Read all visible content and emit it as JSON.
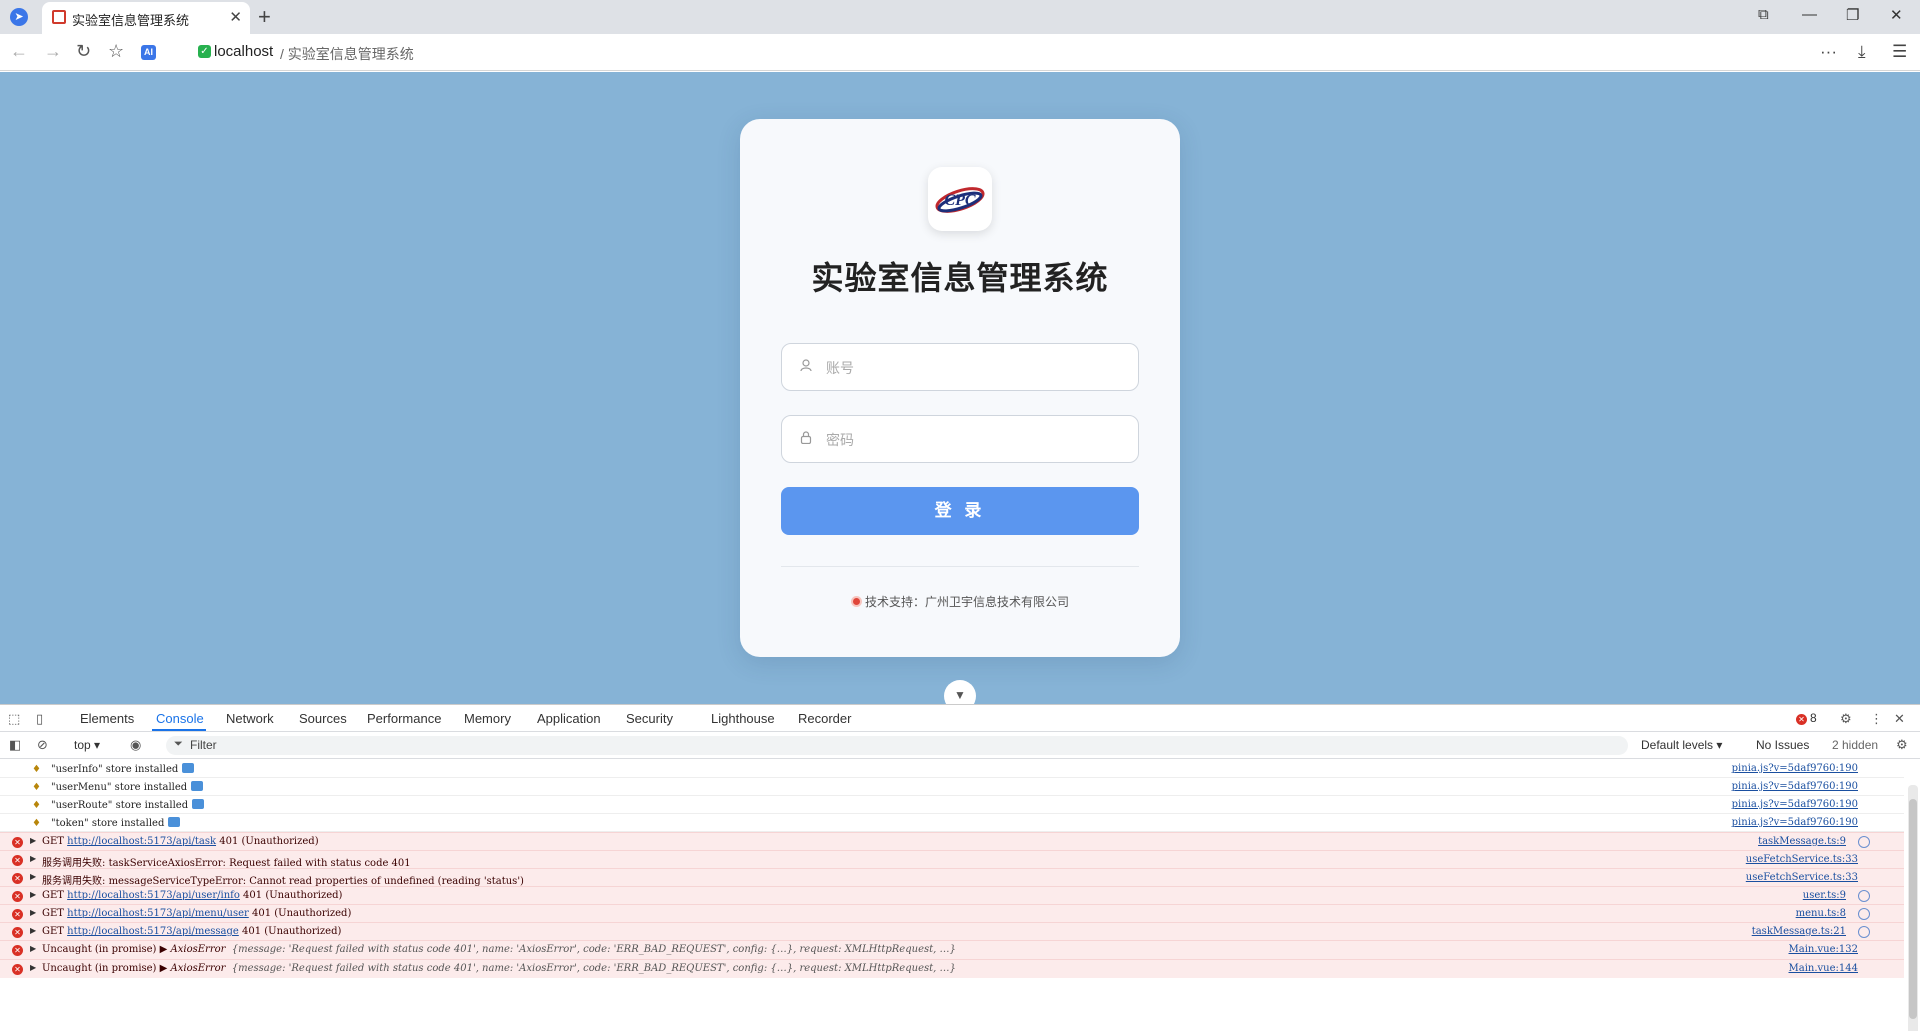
{
  "browser": {
    "tab_title": "实验室信息管理系统",
    "tab_close": "✕",
    "new_tab": "+",
    "url_host": "localhost",
    "url_path": "/ 实验室信息管理系统",
    "menu_dots": "···",
    "menu_icon": "☰"
  },
  "login": {
    "title": "实验室信息管理系统",
    "account_placeholder": "账号",
    "password_placeholder": "密码",
    "login_button": "登 录",
    "support_text": "技术支持：广州卫宇信息技术有限公司",
    "logo_text": "CPC",
    "colors": {
      "page_bg": "#86b3d6",
      "button": "#5b96ef",
      "card": "#f7f9fc"
    }
  },
  "devtools": {
    "tabs": [
      "Elements",
      "Console",
      "Network",
      "Sources",
      "Performance",
      "Memory",
      "Application",
      "Security",
      "Lighthouse",
      "Recorder"
    ],
    "active_tab": "Console",
    "error_count": "8",
    "context": "top ▾",
    "filter_placeholder": "Filter",
    "levels": "Default levels ▾",
    "issues": "No Issues",
    "hidden": "2 hidden",
    "logs": [
      {
        "msg": "\"userInfo\" store installed",
        "src": "pinia.js?v=5daf9760:190"
      },
      {
        "msg": "\"userMenu\" store installed",
        "src": "pinia.js?v=5daf9760:190"
      },
      {
        "msg": "\"userRoute\" store installed",
        "src": "pinia.js?v=5daf9760:190"
      },
      {
        "msg": "\"token\" store installed",
        "src": "pinia.js?v=5daf9760:190"
      }
    ],
    "errors": [
      {
        "prefix": "GET",
        "link": "http://localhost:5173/api/task",
        "rest": "401 (Unauthorized)",
        "src": "taskMessage.ts:9"
      },
      {
        "prefix": "服务调用失败:",
        "link": "",
        "rest": "taskServiceAxiosError: Request failed with status code 401",
        "src": "useFetchService.ts:33"
      },
      {
        "prefix": "服务调用失败:",
        "link": "",
        "rest": "messageServiceTypeError: Cannot read properties of undefined (reading 'status')",
        "src": "useFetchService.ts:33"
      },
      {
        "prefix": "GET",
        "link": "http://localhost:5173/api/user/info",
        "rest": "401 (Unauthorized)",
        "src": "user.ts:9"
      },
      {
        "prefix": "GET",
        "link": "http://localhost:5173/api/menu/user",
        "rest": "401 (Unauthorized)",
        "src": "menu.ts:8"
      },
      {
        "prefix": "GET",
        "link": "http://localhost:5173/api/message",
        "rest": "401 (Unauthorized)",
        "src": "taskMessage.ts:21"
      }
    ],
    "uncaught": [
      {
        "prefix": "Uncaught (in promise)",
        "type": "AxiosError",
        "body": "{message: 'Request failed with status code 401', name: 'AxiosError', code: 'ERR_BAD_REQUEST', config: {…}, request: XMLHttpRequest, …}",
        "src": "Main.vue:132"
      },
      {
        "prefix": "Uncaught (in promise)",
        "type": "AxiosError",
        "body": "{message: 'Request failed with status code 401', name: 'AxiosError', code: 'ERR_BAD_REQUEST', config: {…}, request: XMLHttpRequest, …}",
        "src": "Main.vue:144"
      }
    ]
  }
}
